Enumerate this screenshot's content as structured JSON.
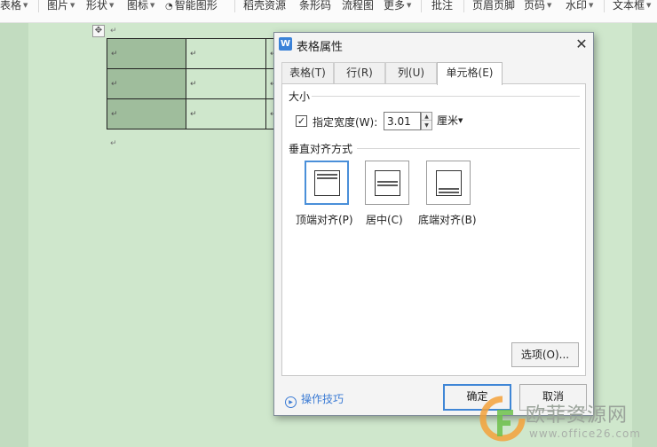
{
  "ribbon": {
    "items": [
      {
        "label": "表格",
        "dropdown": true
      },
      {
        "label": "图片",
        "dropdown": true
      },
      {
        "label": "形状",
        "dropdown": true
      },
      {
        "label": "图标",
        "dropdown": true
      },
      {
        "label": "智能图形",
        "dropdown": false
      },
      {
        "label": "稻壳资源",
        "dropdown": false
      },
      {
        "label": "条形码",
        "dropdown": false
      },
      {
        "label": "流程图",
        "dropdown": false
      },
      {
        "label": "更多",
        "dropdown": true
      },
      {
        "label": "批注",
        "dropdown": false
      },
      {
        "label": "页眉页脚",
        "dropdown": false
      },
      {
        "label": "页码",
        "dropdown": true
      },
      {
        "label": "水印",
        "dropdown": true
      },
      {
        "label": "文本框",
        "dropdown": true
      }
    ]
  },
  "document": {
    "paragraph_mark": "↵",
    "table": {
      "rows": 3,
      "columns": 3,
      "selected_column": 1
    }
  },
  "dialog": {
    "title": "表格属性",
    "close_symbol": "✕",
    "tabs": [
      {
        "label": "表格(T)",
        "active": false
      },
      {
        "label": "行(R)",
        "active": false
      },
      {
        "label": "列(U)",
        "active": false
      },
      {
        "label": "单元格(E)",
        "active": true
      }
    ],
    "size_group": {
      "title": "大小",
      "specify_width_label": "指定宽度(W):",
      "specify_width_checked": true,
      "width_value": "3.01",
      "unit": "厘米"
    },
    "vertical_alignment": {
      "title": "垂直对齐方式",
      "options": [
        {
          "label": "顶端对齐(P)",
          "icon": "align-top-icon",
          "selected": true
        },
        {
          "label": "居中(C)",
          "icon": "align-center-icon",
          "selected": false
        },
        {
          "label": "底端对齐(B)",
          "icon": "align-bottom-icon",
          "selected": false
        }
      ]
    },
    "options_button": "选项(O)...",
    "tips_link": "操作技巧",
    "ok_button": "确定",
    "cancel_button": "取消"
  },
  "watermark": {
    "title": "欧菲资源网",
    "url": "www.office26.com"
  },
  "colors": {
    "page_background": "#cfe7cc",
    "selected_cells": "#9fbd9c",
    "accent_blue": "#3f86d6",
    "link_blue": "#3b7bd4",
    "watermark_orange": "#f3a13a",
    "watermark_green": "#6cbf4a"
  }
}
